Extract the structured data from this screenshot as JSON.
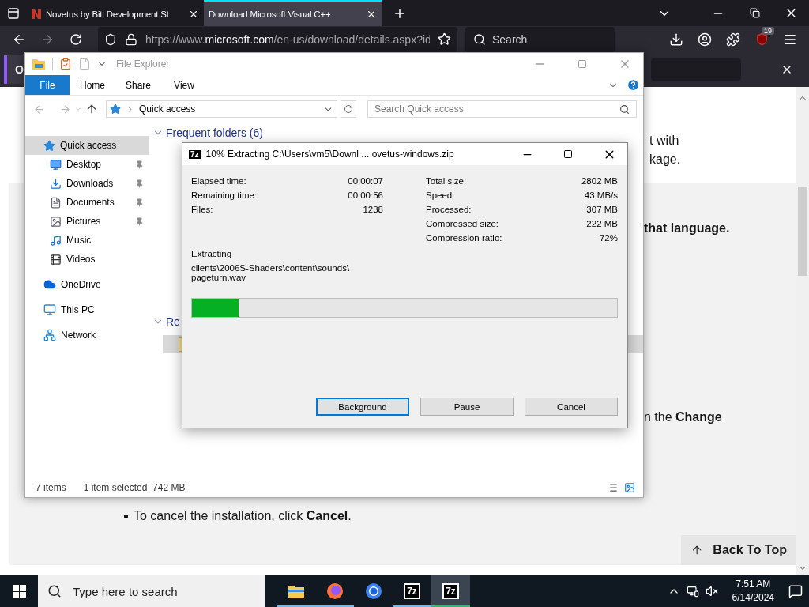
{
  "browser": {
    "tabs": [
      {
        "title": "Novetus by Bitl Development St",
        "selected": false
      },
      {
        "title": "Download Microsoft Visual C++",
        "selected": true
      }
    ],
    "address": {
      "scheme": "https://www.",
      "host": "microsoft.com",
      "path": "/en-us/download/details.aspx?id"
    },
    "search": {
      "placeholder": "Search"
    },
    "badge": "19",
    "notification": {
      "label": "O"
    }
  },
  "page": {
    "top_lines": [
      {
        "text": "t with",
        "bold": false
      },
      {
        "text": "kage.",
        "bold": false
      }
    ],
    "box_lines": [
      {
        "text": "that language.",
        "bold": true
      }
    ],
    "change_line": "n the **Change**",
    "bullets": [
      "To cancel the installation, click **Cancel**."
    ],
    "back_to_top": "Back To Top"
  },
  "explorer": {
    "title": "File Explorer",
    "active": false,
    "ribbon_tabs": [
      {
        "label": "File",
        "kind": "file"
      },
      {
        "label": "Home",
        "kind": "tab"
      },
      {
        "label": "Share",
        "kind": "tab"
      },
      {
        "label": "View",
        "kind": "tab"
      }
    ],
    "location": "Quick access",
    "search": {
      "placeholder": "Search Quick access"
    },
    "nav": [
      {
        "label": "Quick access",
        "selected": true,
        "children": [
          {
            "label": "Desktop",
            "pinned": true,
            "selected": false
          },
          {
            "label": "Downloads",
            "pinned": true,
            "selected": false
          },
          {
            "label": "Documents",
            "pinned": true,
            "selected": false
          },
          {
            "label": "Pictures",
            "pinned": true,
            "selected": false
          },
          {
            "label": "Music",
            "pinned": false,
            "selected": false
          },
          {
            "label": "Videos",
            "pinned": false,
            "selected": false
          }
        ]
      },
      {
        "label": "OneDrive",
        "selected": false
      },
      {
        "label": "This PC",
        "selected": false
      },
      {
        "label": "Network",
        "selected": false
      }
    ],
    "groups": [
      {
        "title": "Frequent folders (6)",
        "expanded": true
      },
      {
        "title": "Re",
        "expanded": true
      }
    ],
    "recent_row": {
      "selected": true
    },
    "status": {
      "count": "7 items",
      "selection": "1 item selected",
      "size": "742 MB"
    }
  },
  "dialog": {
    "icon": "7z",
    "title": "10% Extracting C:\\Users\\vm5\\Downl ... ovetus-windows.zip",
    "left_stats": [
      {
        "label": "Elapsed time:",
        "value": "00:00:07"
      },
      {
        "label": "Remaining time:",
        "value": "00:00:56"
      },
      {
        "label": "Files:",
        "value": "1238"
      }
    ],
    "right_stats": [
      {
        "label": "Total size:",
        "value": "2802 MB"
      },
      {
        "label": "Speed:",
        "value": "43 MB/s"
      },
      {
        "label": "Processed:",
        "value": "307 MB"
      },
      {
        "label": "Compressed size:",
        "value": "222 MB"
      },
      {
        "label": "Compression ratio:",
        "value": "72%"
      }
    ],
    "action": "Extracting",
    "path": [
      "clients\\2006S-Shaders\\content\\sounds\\",
      "pageturn.wav"
    ],
    "progress": {
      "level": 0.11
    },
    "buttons": [
      {
        "label": "Background",
        "focused": true
      },
      {
        "label": "Pause",
        "focused": false
      },
      {
        "label": "Cancel",
        "focused": false
      }
    ]
  },
  "taskbar": {
    "search": {
      "placeholder": "Type here to search"
    },
    "apps": [
      {
        "kind": "explorer",
        "running": true,
        "active": false
      },
      {
        "kind": "firefox",
        "running": true,
        "active": false
      },
      {
        "kind": "chromium",
        "running": false,
        "active": false
      },
      {
        "kind": "sevenzip",
        "label": "7z",
        "running": true,
        "active": false
      },
      {
        "kind": "sevenzip",
        "label": "7z",
        "running": true,
        "active": true
      }
    ],
    "clock": {
      "time": "7:51 AM",
      "date": "6/14/2024"
    }
  }
}
